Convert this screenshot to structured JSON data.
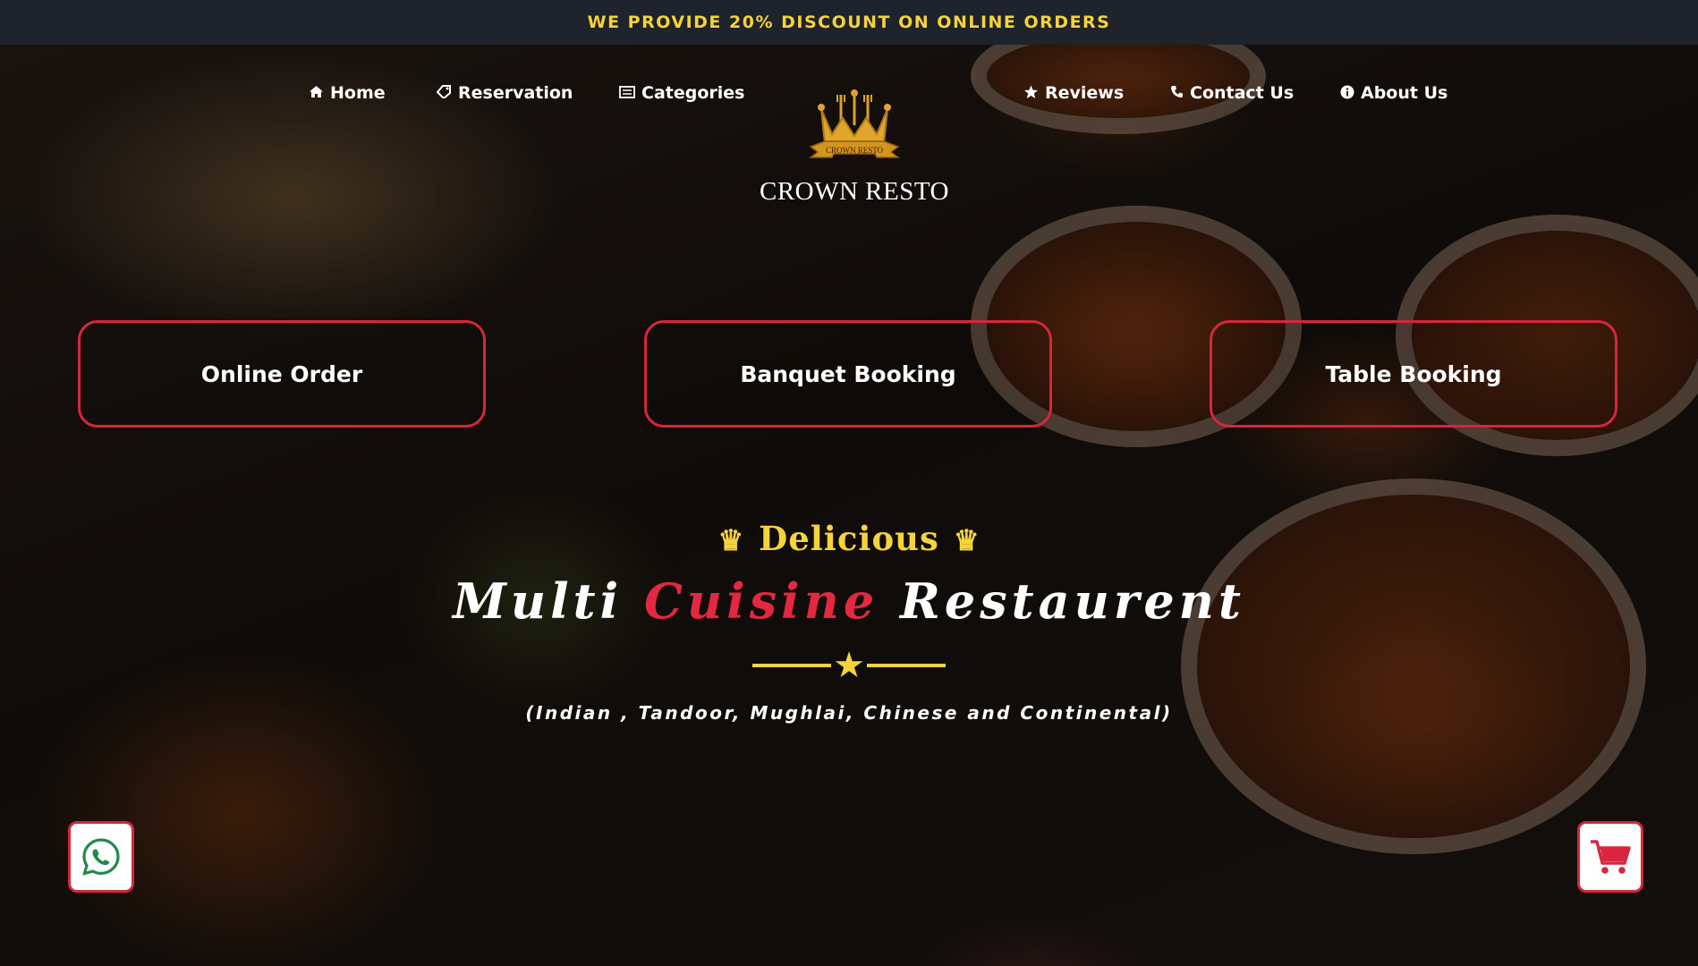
{
  "promo_bar": {
    "text": "WE PROVIDE 20% DISCOUNT ON ONLINE ORDERS",
    "color": "#f5d33c"
  },
  "nav": {
    "left": [
      {
        "label": "Home",
        "icon": "home-icon"
      },
      {
        "label": "Reservation",
        "icon": "tag-icon"
      },
      {
        "label": "Categories",
        "icon": "list-icon"
      }
    ],
    "right": [
      {
        "label": "Reviews",
        "icon": "star-icon"
      },
      {
        "label": "Contact Us",
        "icon": "phone-icon"
      },
      {
        "label": "About Us",
        "icon": "info-icon"
      }
    ]
  },
  "logo": {
    "badge_text": "CROWN RESTO",
    "name": "CROWN RESTO"
  },
  "actions": [
    {
      "label": "Online Order"
    },
    {
      "label": "Banquet Booking"
    },
    {
      "label": "Table Booking"
    }
  ],
  "hero": {
    "tagline": "Delicious",
    "title_part1": "Multi",
    "title_accent": "Cuisine",
    "title_part2": "Restaurent",
    "subtitle": "(Indian , Tandoor, Mughlai, Chinese and Continental)"
  },
  "floating": {
    "whatsapp_icon": "whatsapp-icon",
    "cart_icon": "cart-icon"
  },
  "colors": {
    "accent_red": "#d7263d",
    "accent_yellow": "#f5d33c",
    "topbar_bg": "#1f232b"
  }
}
